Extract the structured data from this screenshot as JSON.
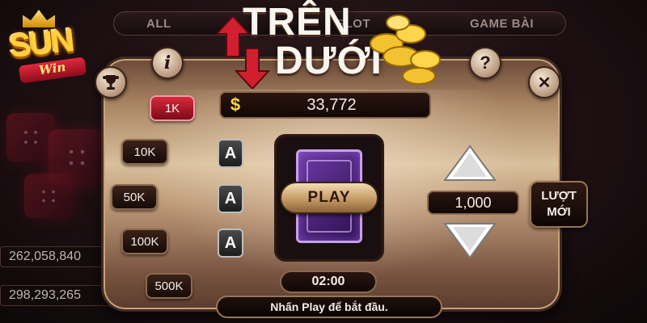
{
  "lobby": {
    "tabs": [
      "ALL",
      "SLOT",
      "GAME BÀI"
    ],
    "jackpots": [
      "262,058,840",
      "298,293,265"
    ]
  },
  "logo": {
    "brand": "SUN",
    "sub": "Win"
  },
  "game": {
    "title_top": "TRÊN",
    "title_bottom": "DƯỚI",
    "balance_symbol": "$",
    "balance": "33,772",
    "chips": [
      "1K",
      "10K",
      "50K",
      "100K",
      "500K"
    ],
    "active_chip": "1K",
    "card_slots": [
      "A",
      "A",
      "A"
    ],
    "play_label": "PLAY",
    "timer": "02:00",
    "bet_amount": "1,000",
    "new_turn_line1": "LƯỢT",
    "new_turn_line2": "MỚI",
    "status": "Nhấn Play để bắt đầu.",
    "info_symbol": "i",
    "help_symbol": "?",
    "close_symbol": "✕"
  },
  "colors": {
    "accent_red": "#d62a3d",
    "gold": "#ffd54a",
    "panel_light": "#d9bf9c",
    "card_purple": "#6d3aa4"
  },
  "icons": [
    "trophy-icon",
    "info-icon",
    "help-icon",
    "close-icon",
    "up-arrow-icon",
    "down-arrow-icon",
    "coin-stack-icon"
  ]
}
